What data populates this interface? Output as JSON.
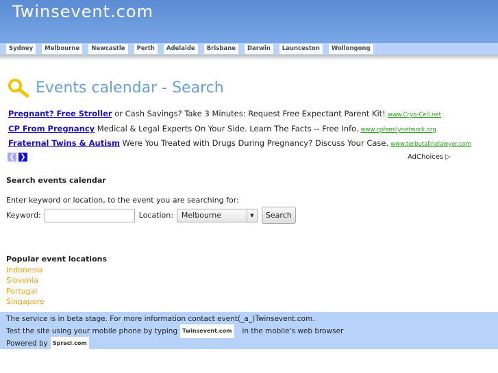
{
  "site": {
    "logo": "Twinsevent.com"
  },
  "nav": [
    "Sydney",
    "Melbourne",
    "Newcastle",
    "Perth",
    "Adelaide",
    "Brisbane",
    "Darwin",
    "Launceston",
    "Wollongong"
  ],
  "page": {
    "title": "Events calendar - Search",
    "icon": "magnifier-icon"
  },
  "ads": [
    {
      "headline": "Pregnant? Free Stroller",
      "text": "or Cash Savings? Take 3 Minutes: Request Free Expectant Parent Kit!",
      "url": "www.Cryo-Cell.net"
    },
    {
      "headline": "CP From Pregnancy",
      "text": "Medical & Legal Experts On Your Side. Learn The Facts -- Free Info.",
      "url": "www.cpfamilynetwork.org"
    },
    {
      "headline": "Fraternal Twins & Autism",
      "text": "Were You Treated with Drugs During Pregnancy? Discuss Your Case.",
      "url": "www.terbutalinelawyer.com"
    }
  ],
  "adchoices": "AdChoices",
  "search": {
    "heading": "Search events calendar",
    "intro": "Enter keyword or location, to the event you are searching for:",
    "keyword_label": "Keyword:",
    "keyword_value": "",
    "location_label": "Location:",
    "location_value": "Melbourne",
    "button": "Search"
  },
  "popular": {
    "heading": "Popular event locations",
    "items": [
      "Indonesia",
      "Slovenia",
      "Portugal",
      "Singapore"
    ]
  },
  "footer": {
    "line1": "The service is in beta stage. For more information contact event(_a_)Twinsevent.com.",
    "line2_pre": "Test the site using your mobile phone by typing",
    "line2_chip": "Twinsevent.com",
    "line2_post": "in the mobile's web browser",
    "line3_pre": "Powered by",
    "line3_chip": "Spraci.com"
  },
  "colors": {
    "header": "#5a8bd3",
    "nav": "#b8d3fb",
    "title": "#6a9fd6",
    "link_orange": "#f7a21b",
    "ad_link": "#1a0dcc",
    "ad_url": "#2aa31a"
  }
}
